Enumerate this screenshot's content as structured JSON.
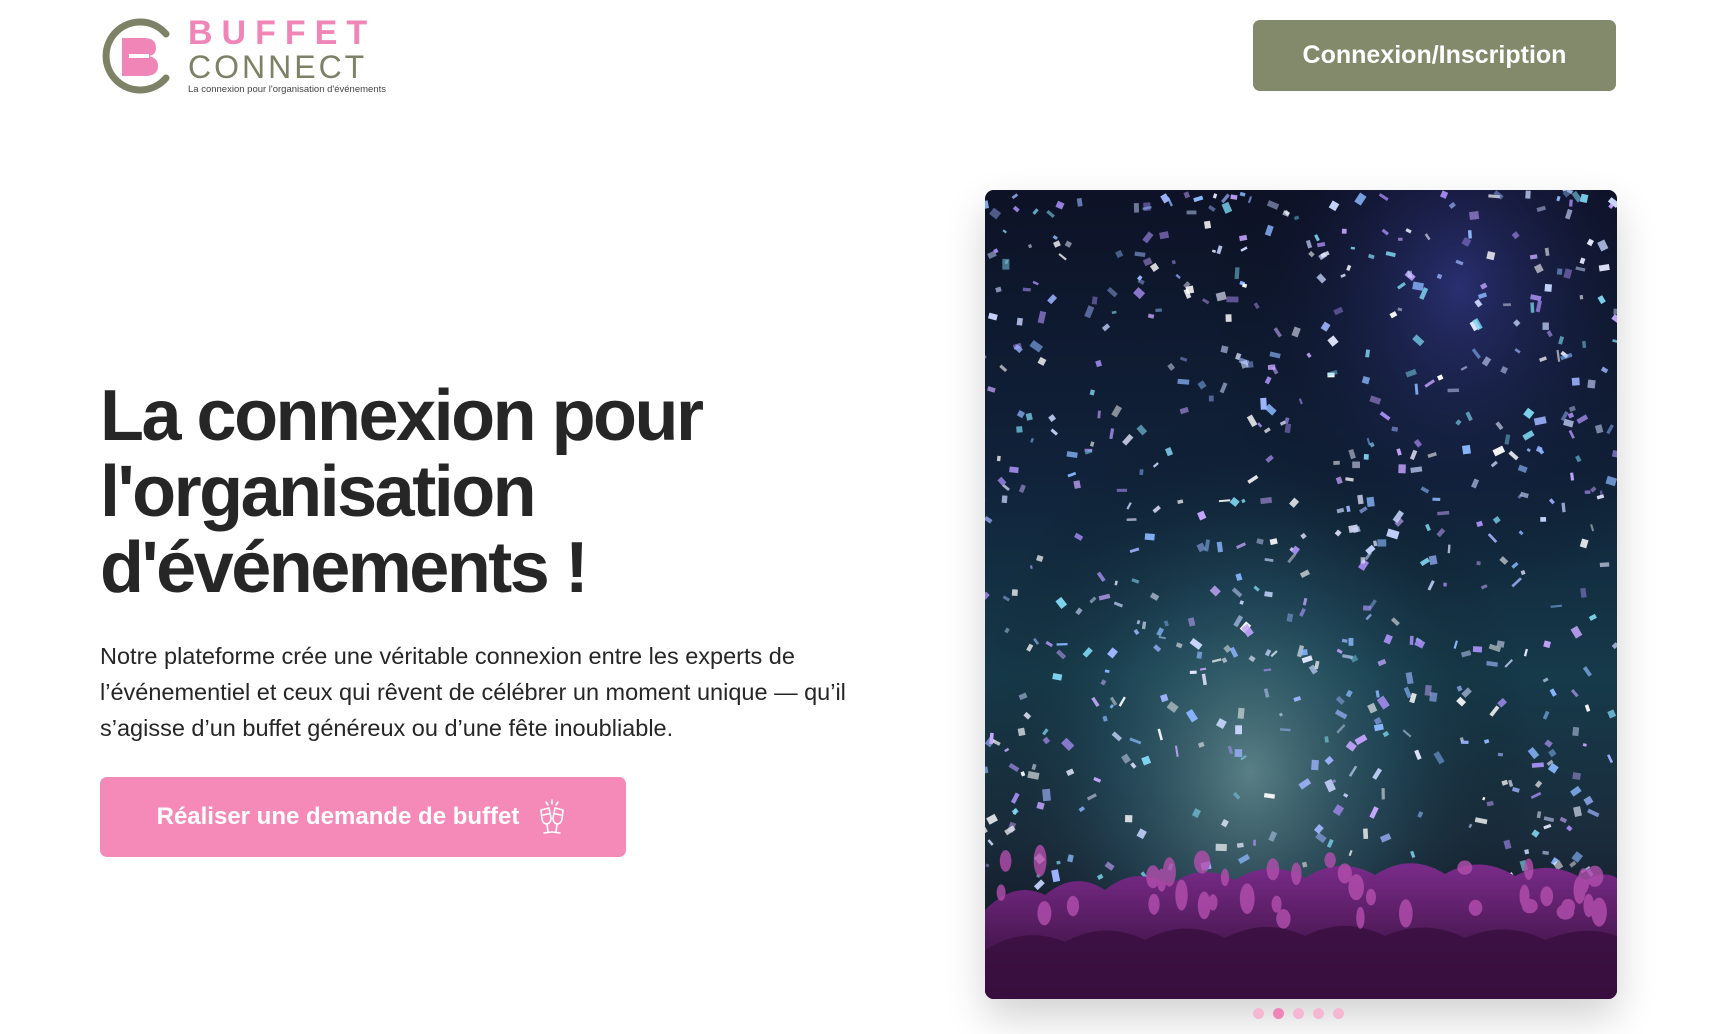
{
  "header": {
    "logo": {
      "word1": "BUFFET",
      "word2": "CONNECT",
      "tagline": "La connexion pour l'organisation d'événements"
    },
    "login_label": "Connexion/Inscription"
  },
  "hero": {
    "title": "La connexion pour l'organisation d'événements !",
    "text": "Notre plateforme crée une véritable connexion entre les experts de l’événementiel et ceux qui rêvent de célébrer un moment unique — qu’il s’agisse d’un buffet généreux ou d’une fête inoubliable.",
    "cta_label": "Réaliser une demande de buffet",
    "cta_icon": "champagne-toast-icon"
  },
  "carousel": {
    "image": "concert-confetti-crowd-photo",
    "slide_count": 5,
    "active_index": 1
  },
  "colors": {
    "brand_pink": "#f58ab9",
    "brand_olive": "#838a6c",
    "text_dark": "#262626"
  }
}
